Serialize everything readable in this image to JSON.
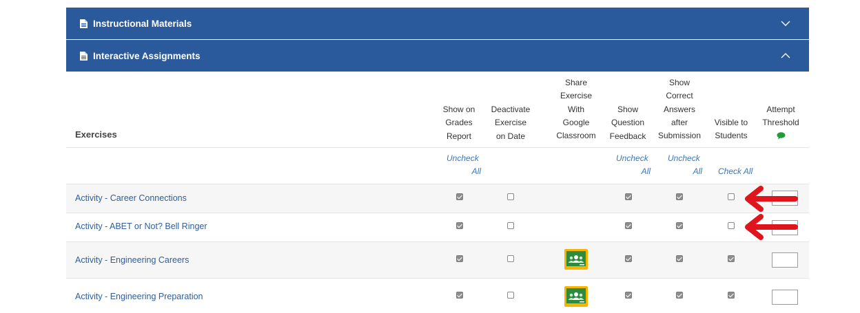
{
  "panels": [
    {
      "title": "Instructional Materials",
      "state": "collapsed"
    },
    {
      "title": "Interactive Assignments",
      "state": "expanded"
    }
  ],
  "table": {
    "exercises_header": "Exercises",
    "columns": [
      {
        "label_lines": [
          "Show on",
          "Grades",
          "Report"
        ],
        "bulk_action": [
          "Uncheck",
          "All"
        ]
      },
      {
        "label_lines": [
          "Deactivate",
          "Exercise",
          "on Date"
        ],
        "bulk_action": null
      },
      {
        "label_lines": [
          "Share",
          "Exercise",
          "With",
          "Google",
          "Classroom"
        ],
        "bulk_action": null
      },
      {
        "label_lines": [
          "Show",
          "Question",
          "Feedback"
        ],
        "bulk_action": [
          "Uncheck",
          "All"
        ]
      },
      {
        "label_lines": [
          "Show",
          "Correct",
          "Answers",
          "after",
          "Submission"
        ],
        "bulk_action": [
          "Uncheck",
          "All"
        ]
      },
      {
        "label_lines": [
          "Visible to",
          "Students"
        ],
        "bulk_action": [
          "Check All"
        ]
      },
      {
        "label_lines": [
          "Attempt",
          "Threshold"
        ],
        "bulk_action": null,
        "icon": "comment-icon"
      }
    ],
    "rows": [
      {
        "name": "Activity - Career Connections",
        "show_grades": true,
        "deactivate": false,
        "google_classroom": false,
        "question_feedback": true,
        "correct_answers": true,
        "visible": false,
        "threshold": ""
      },
      {
        "name": "Activity - ABET or Not? Bell Ringer",
        "show_grades": true,
        "deactivate": false,
        "google_classroom": false,
        "question_feedback": true,
        "correct_answers": true,
        "visible": false,
        "threshold": ""
      },
      {
        "name": "Activity - Engineering Careers",
        "show_grades": true,
        "deactivate": false,
        "google_classroom": true,
        "question_feedback": true,
        "correct_answers": true,
        "visible": true,
        "threshold": ""
      },
      {
        "name": "Activity - Engineering Preparation",
        "show_grades": true,
        "deactivate": false,
        "google_classroom": true,
        "question_feedback": true,
        "correct_answers": true,
        "visible": true,
        "threshold": ""
      }
    ]
  },
  "colors": {
    "panel_bar": "#2b5a9c",
    "link": "#2e5e9c",
    "annotation_arrow": "#e0141c",
    "google_classroom_green": "#2e8b3d",
    "google_classroom_yellow": "#f4b400",
    "comment_icon": "#1f9d3b"
  },
  "icons": {
    "panel": "document-icon",
    "collapsed": "chevron-down-icon",
    "expanded": "chevron-up-icon",
    "share": "google-classroom-icon",
    "annotation": "red-arrow-icon"
  }
}
